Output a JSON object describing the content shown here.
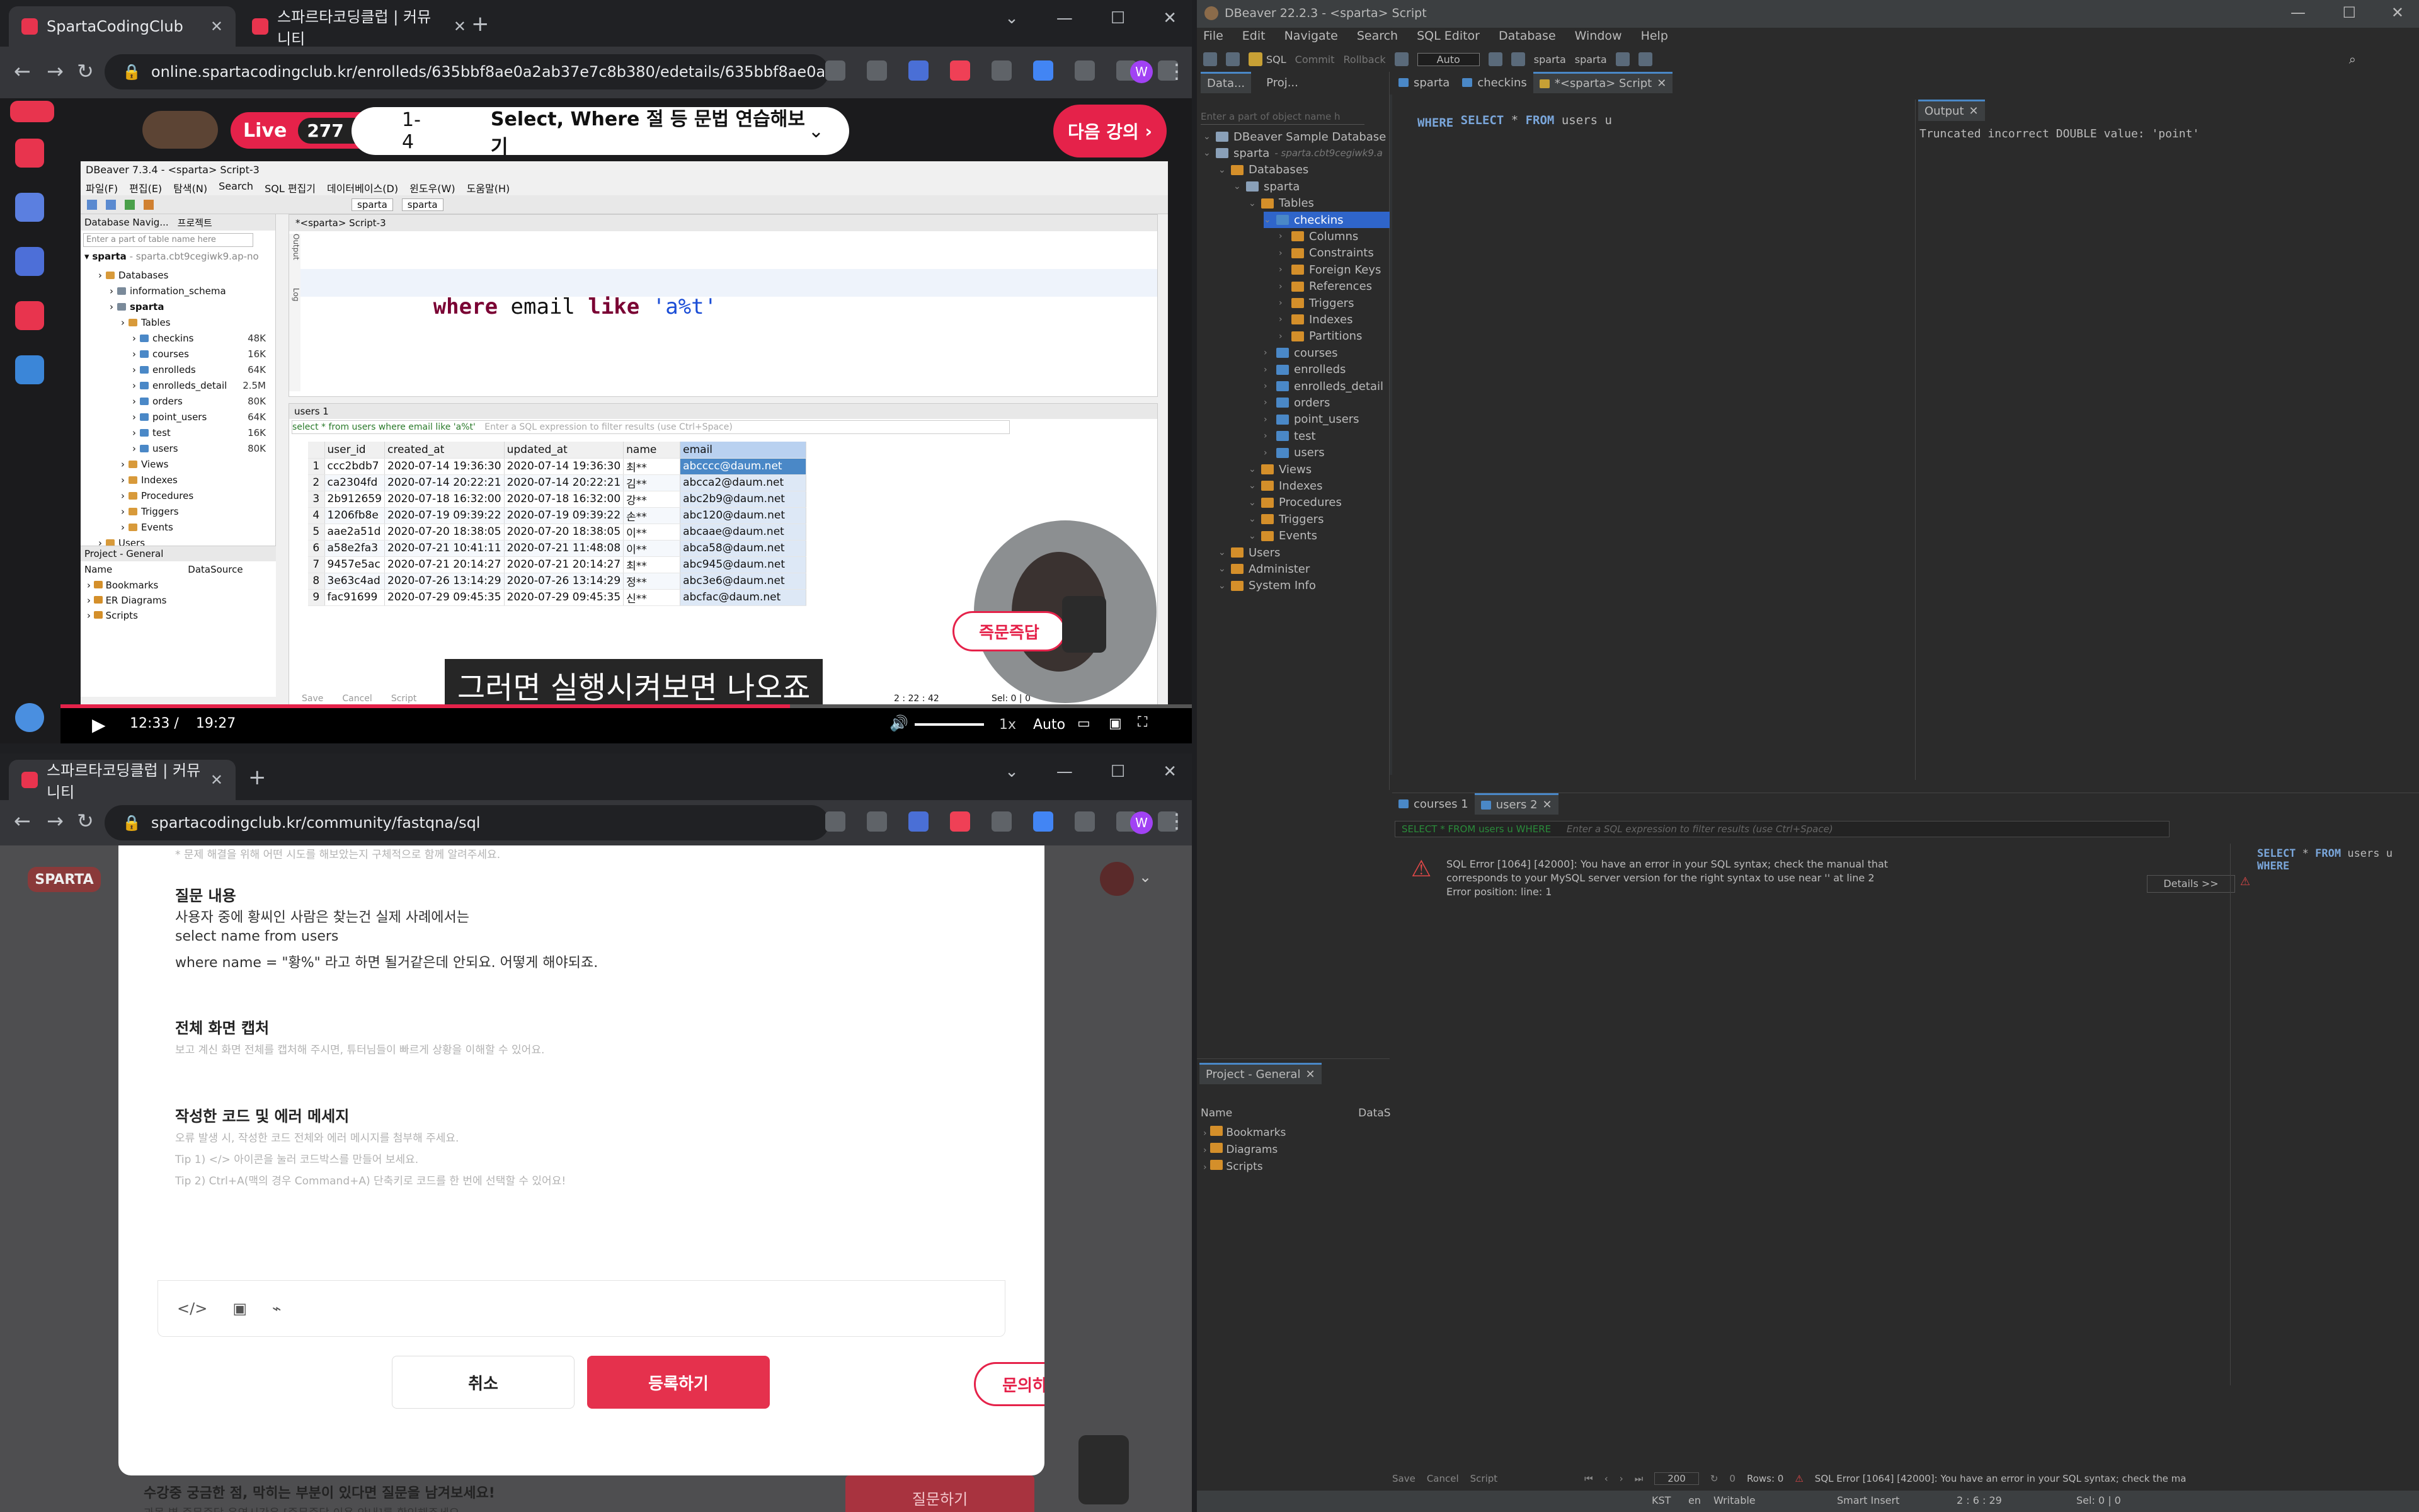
{
  "video_browser": {
    "tabs": [
      {
        "label": "SpartaCodingClub",
        "active": true
      },
      {
        "label": "스파르타코딩클럽 | 커뮤니티",
        "active": false
      }
    ],
    "url": "online.spartacodingclub.kr/enrolleds/635bbf8ae0a2ab37e7c8b380/edetails/635bbf8ae0a2ab37e7c8b387?course...",
    "live_label": "Live",
    "viewer_count": "277",
    "lesson_number": "1-4",
    "lesson_title": "Select, Where 절 등 문법 연습해보기",
    "next_button": "다음 강의",
    "caption": "그러면 실행시켜보면 나오죠",
    "time_current": "12:33",
    "time_separator": "/",
    "time_total": "19:27",
    "speed": "1x",
    "quality": "Auto",
    "instant_answer": "즉문즉답"
  },
  "inner_dbeaver": {
    "title": "DBeaver 7.3.4 - <sparta> Script-3",
    "menu": [
      "파일(F)",
      "편집(E)",
      "탐색(N)",
      "Search",
      "SQL 편집기",
      "데이터베이스(D)",
      "윈도우(W)",
      "도움말(H)"
    ],
    "nav_tab": "Database Navig...",
    "project_tab": "프로젝트",
    "filter_placeholder": "Enter a part of table name here",
    "connection": "sparta",
    "connection_host": "- sparta.cbt9cegiwk9.ap-no",
    "tree": [
      {
        "label": "Databases",
        "level": 1,
        "type": "folder"
      },
      {
        "label": "information_schema",
        "level": 2,
        "type": "db"
      },
      {
        "label": "sparta",
        "level": 2,
        "type": "db",
        "bold": true
      },
      {
        "label": "Tables",
        "level": 3,
        "type": "folder"
      },
      {
        "label": "checkins",
        "level": 4,
        "type": "table",
        "size": "48K"
      },
      {
        "label": "courses",
        "level": 4,
        "type": "table",
        "size": "16K"
      },
      {
        "label": "enrolleds",
        "level": 4,
        "type": "table",
        "size": "64K"
      },
      {
        "label": "enrolleds_detail",
        "level": 4,
        "type": "table",
        "size": "2.5M"
      },
      {
        "label": "orders",
        "level": 4,
        "type": "table",
        "size": "80K"
      },
      {
        "label": "point_users",
        "level": 4,
        "type": "table",
        "size": "64K"
      },
      {
        "label": "test",
        "level": 4,
        "type": "table",
        "size": "16K"
      },
      {
        "label": "users",
        "level": 4,
        "type": "table",
        "size": "80K"
      },
      {
        "label": "Views",
        "level": 3,
        "type": "folder"
      },
      {
        "label": "Indexes",
        "level": 3,
        "type": "folder"
      },
      {
        "label": "Procedures",
        "level": 3,
        "type": "folder"
      },
      {
        "label": "Triggers",
        "level": 3,
        "type": "folder"
      },
      {
        "label": "Events",
        "level": 3,
        "type": "folder"
      },
      {
        "label": "Users",
        "level": 1,
        "type": "folder"
      }
    ],
    "project_panel_title": "Project - General",
    "project_cols": [
      "Name",
      "DataSource"
    ],
    "project_items": [
      "Bookmarks",
      "ER Diagrams",
      "Scripts"
    ],
    "editor_tab": "*<sparta> Script-3",
    "query_kw1": "select",
    "query_rest1": " * ",
    "query_kw2": "from",
    "query_rest2": " users",
    "query_kw3": "where",
    "query_rest3": " email ",
    "query_kw4": "like",
    "query_str": "'a%t'",
    "results_tab": "users 1",
    "results_query": "select * from users where email like 'a%t'",
    "filter_hint": "Enter a SQL expression to filter results (use Ctrl+Space)",
    "columns": [
      "user_id",
      "created_at",
      "updated_at",
      "name",
      "email"
    ],
    "rows": [
      [
        "1",
        "ccc2bdb7",
        "2020-07-14 19:36:30",
        "2020-07-14 19:36:30",
        "최**",
        "abcccc@daum.net"
      ],
      [
        "2",
        "ca2304fd",
        "2020-07-14 20:22:21",
        "2020-07-14 20:22:21",
        "김**",
        "abcca2@daum.net"
      ],
      [
        "3",
        "2b912659",
        "2020-07-18 16:32:00",
        "2020-07-18 16:32:00",
        "강**",
        "abc2b9@daum.net"
      ],
      [
        "4",
        "1206fb8e",
        "2020-07-19 09:39:22",
        "2020-07-19 09:39:22",
        "손**",
        "abc120@daum.net"
      ],
      [
        "5",
        "aae2a51d",
        "2020-07-20 18:38:05",
        "2020-07-20 18:38:05",
        "이**",
        "abcaae@daum.net"
      ],
      [
        "6",
        "a58e2fa3",
        "2020-07-21 10:41:11",
        "2020-07-21 11:48:08",
        "이**",
        "abca58@daum.net"
      ],
      [
        "7",
        "9457e5ac",
        "2020-07-21 20:14:27",
        "2020-07-21 20:14:27",
        "최**",
        "abc945@daum.net"
      ],
      [
        "8",
        "3e63c4ad",
        "2020-07-26 13:14:29",
        "2020-07-26 13:14:29",
        "정**",
        "abc3e6@daum.net"
      ],
      [
        "9",
        "fac91699",
        "2020-07-29 09:45:35",
        "2020-07-29 09:45:35",
        "신**",
        "abcfac@daum.net"
      ]
    ],
    "bottom_actions": [
      "Save",
      "Cancel",
      "Script"
    ],
    "cursor_pos": "2 : 22 : 42",
    "sel": "Sel: 0 | 0",
    "side_labels": [
      "Output",
      "Log"
    ]
  },
  "community_browser": {
    "tabs": [
      {
        "label": "스파르타코딩클럽 | 커뮤니티",
        "active": true
      }
    ],
    "url": "spartacodingclub.kr/community/fastqna/sql",
    "logo": "SPARTA",
    "top_hint": "* 문제 해결을 위해 어떤 시도를 해보았는지 구체적으로 함께 알려주세요.",
    "question_heading": "질문 내용",
    "question_lines": [
      "사용자 중에 황씨인 사람은 찾는건 실제 사례에서는",
      "select name from users",
      "where name = \"황%\" 라고 하면 될거같은데 안되요. 어떻게 해야되죠."
    ],
    "capture_heading": "전체 화면 캡처",
    "capture_guide": "보고 계신 화면 전체를 캡처해 주시면, 튜터님들이 빠르게 상황을 이해할 수 있어요.",
    "code_heading": "작성한 코드 및 에러 메세지",
    "code_guides": [
      "오류 발생 시, 작성한 코드 전체와 에러 메시지를 첨부해 주세요.",
      "Tip 1) </> 아이콘을 눌러 코드박스를 만들어 보세요.",
      "Tip 2) Ctrl+A(맥의 경우 Command+A) 단축키로 코드를 한 번에 선택할 수 있어요!"
    ],
    "cancel_button": "취소",
    "submit_button": "등록하기",
    "inquiry_button": "문의하기",
    "footer_bold": "수강중 궁금한 점, 막히는 부분이 있다면 질문을 남겨보세요!",
    "footer_sub": "과목 별 즉문즉답 운영시간은 [즉문즉답 이용 안내]를 확인해주세요.",
    "ask_button": "질문하기"
  },
  "dbeaver": {
    "title": "DBeaver 22.2.3 - <sparta> Script",
    "menu": [
      "File",
      "Edit",
      "Navigate",
      "Search",
      "SQL Editor",
      "Database",
      "Window",
      "Help"
    ],
    "toolbar_sql": "SQL",
    "toolbar_commit": "Commit",
    "toolbar_rollback": "Rollback",
    "toolbar_auto": "Auto",
    "toolbar_conn": "sparta",
    "toolbar_db": "sparta",
    "left_tabs": [
      "Data...",
      "Proj..."
    ],
    "filter_placeholder": "Enter a part of object name h",
    "tree": [
      {
        "label": "DBeaver Sample Database (SQ",
        "level": 0,
        "type": "db"
      },
      {
        "label": "sparta",
        "level": 0,
        "type": "db",
        "extra": "- sparta.cbt9cegiwk9.a"
      },
      {
        "label": "Databases",
        "level": 1,
        "type": "folder"
      },
      {
        "label": "sparta",
        "level": 2,
        "type": "db"
      },
      {
        "label": "Tables",
        "level": 3,
        "type": "folder"
      },
      {
        "label": "checkins",
        "level": 4,
        "type": "table",
        "selected": true
      },
      {
        "label": "Columns",
        "level": 5,
        "type": "folder"
      },
      {
        "label": "Constraints",
        "level": 5,
        "type": "folder"
      },
      {
        "label": "Foreign Keys",
        "level": 5,
        "type": "folder"
      },
      {
        "label": "References",
        "level": 5,
        "type": "folder"
      },
      {
        "label": "Triggers",
        "level": 5,
        "type": "folder"
      },
      {
        "label": "Indexes",
        "level": 5,
        "type": "folder"
      },
      {
        "label": "Partitions",
        "level": 5,
        "type": "folder"
      },
      {
        "label": "courses",
        "level": 4,
        "type": "table"
      },
      {
        "label": "enrolleds",
        "level": 4,
        "type": "table"
      },
      {
        "label": "enrolleds_detail",
        "level": 4,
        "type": "table"
      },
      {
        "label": "orders",
        "level": 4,
        "type": "table"
      },
      {
        "label": "point_users",
        "level": 4,
        "type": "table"
      },
      {
        "label": "test",
        "level": 4,
        "type": "table"
      },
      {
        "label": "users",
        "level": 4,
        "type": "table"
      },
      {
        "label": "Views",
        "level": 3,
        "type": "folder"
      },
      {
        "label": "Indexes",
        "level": 3,
        "type": "folder"
      },
      {
        "label": "Procedures",
        "level": 3,
        "type": "folder"
      },
      {
        "label": "Triggers",
        "level": 3,
        "type": "folder"
      },
      {
        "label": "Events",
        "level": 3,
        "type": "folder"
      },
      {
        "label": "Users",
        "level": 1,
        "type": "folder"
      },
      {
        "label": "Administer",
        "level": 1,
        "type": "folder"
      },
      {
        "label": "System Info",
        "level": 1,
        "type": "folder"
      }
    ],
    "editor_tabs": [
      "sparta",
      "checkins",
      "*<sparta> Script"
    ],
    "code_line1_kw1": "SELECT",
    "code_line1_mid": " * ",
    "code_line1_kw2": "FROM",
    "code_line1_rest": " users u",
    "code_line2": "WHERE",
    "output_tab": "Output",
    "output_text": "Truncated incorrect DOUBLE value: 'point'",
    "result_tabs": [
      "courses 1",
      "users 2"
    ],
    "result_query": "SELECT * FROM users u WHERE",
    "result_filter_hint": "Enter a SQL expression to filter results (use Ctrl+Space)",
    "error_line1": "SQL Error [1064] [42000]: You have an error in your SQL syntax; check the manual that",
    "error_line2": "corresponds to your MySQL server version for the right syntax to use near '' at line 2",
    "error_line3": "Error position: line: 1",
    "details_button": "Details >>",
    "side_code1_kw": "SELECT",
    "side_code1_mid": " * ",
    "side_code1_kw2": "FROM",
    "side_code1_rest": " users u",
    "side_code2": "WHERE",
    "project_title": "Project - General",
    "project_cols": [
      "Name",
      "DataS"
    ],
    "project_items": [
      "Bookmarks",
      "Diagrams",
      "Scripts"
    ],
    "bottom_actions": [
      "Save",
      "Cancel",
      "Script"
    ],
    "fetch_size": "200",
    "rows_count": "0",
    "rows_label": "Rows: 0",
    "bottom_error": "SQL Error [1064] [42000]: You have an error in your SQL syntax; check the ma",
    "status": [
      "KST",
      "en",
      "Writable",
      "Smart Insert",
      "2 : 6 : 29",
      "Sel: 0 | 0"
    ]
  }
}
